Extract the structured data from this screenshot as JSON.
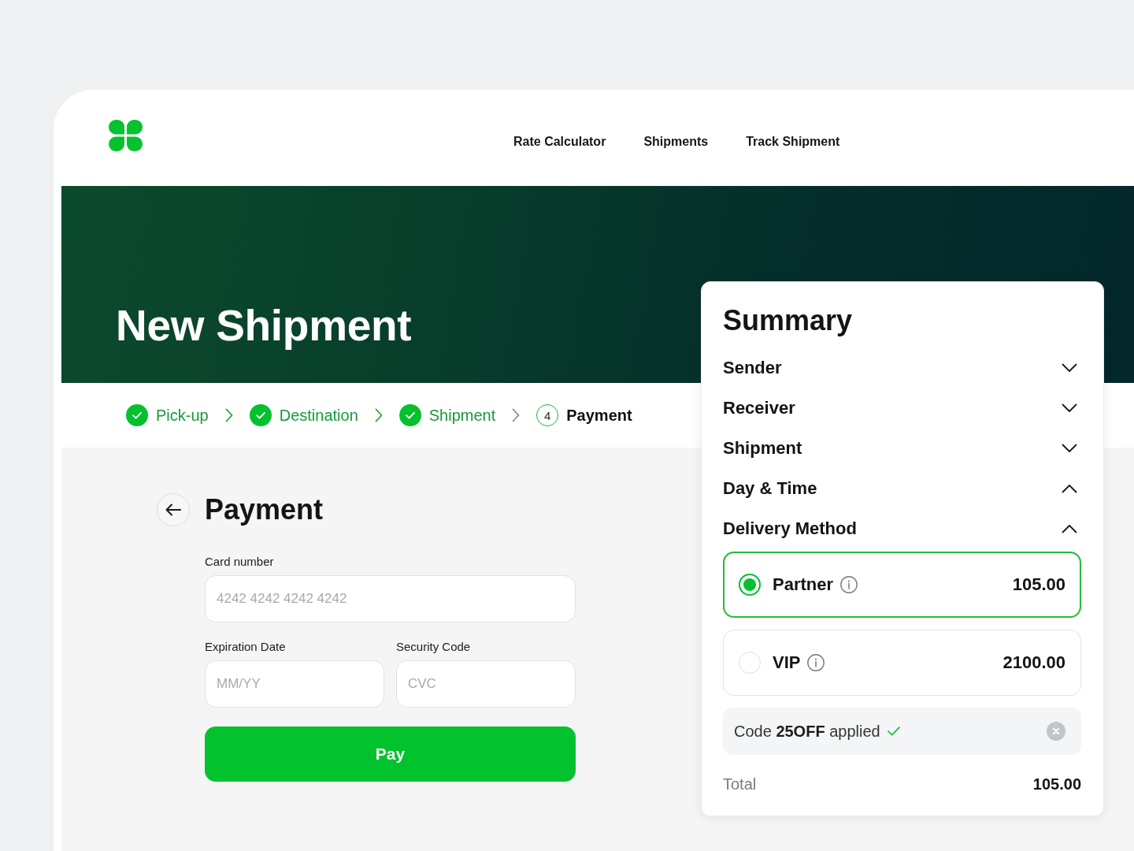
{
  "header": {
    "nav_links": [
      "Rate Calculator",
      "Shipments",
      "Track Shipment"
    ]
  },
  "hero": {
    "title": "New Shipment"
  },
  "steps": [
    {
      "label": "Pick-up",
      "completed": true
    },
    {
      "label": "Destination",
      "completed": true
    },
    {
      "label": "Shipment",
      "completed": true
    },
    {
      "label": "Payment",
      "completed": false,
      "number": "4"
    }
  ],
  "payment": {
    "title": "Payment",
    "card_number": {
      "label": "Card number",
      "placeholder": "4242 4242 4242 4242"
    },
    "expiration_date": {
      "label": "Expiration Date",
      "placeholder": "MM/YY"
    },
    "security_code": {
      "label": "Security Code",
      "placeholder": "CVC"
    },
    "submit_button": "Pay"
  },
  "summary": {
    "title": "Summary",
    "sections": [
      {
        "label": "Sender",
        "expanded": false
      },
      {
        "label": "Receiver",
        "expanded": false
      },
      {
        "label": "Shipment",
        "expanded": false
      },
      {
        "label": "Day & Time",
        "expanded": true
      },
      {
        "label": "Delivery Method",
        "expanded": true
      }
    ],
    "delivery_options": [
      {
        "name": "Partner",
        "price": "105.00",
        "selected": true
      },
      {
        "name": "VIP",
        "price": "2100.00",
        "selected": false
      }
    ],
    "promo_code": {
      "text": "Code **25OFF** applied"
    },
    "total": {
      "label": "Total",
      "value": "105.00"
    }
  }
}
